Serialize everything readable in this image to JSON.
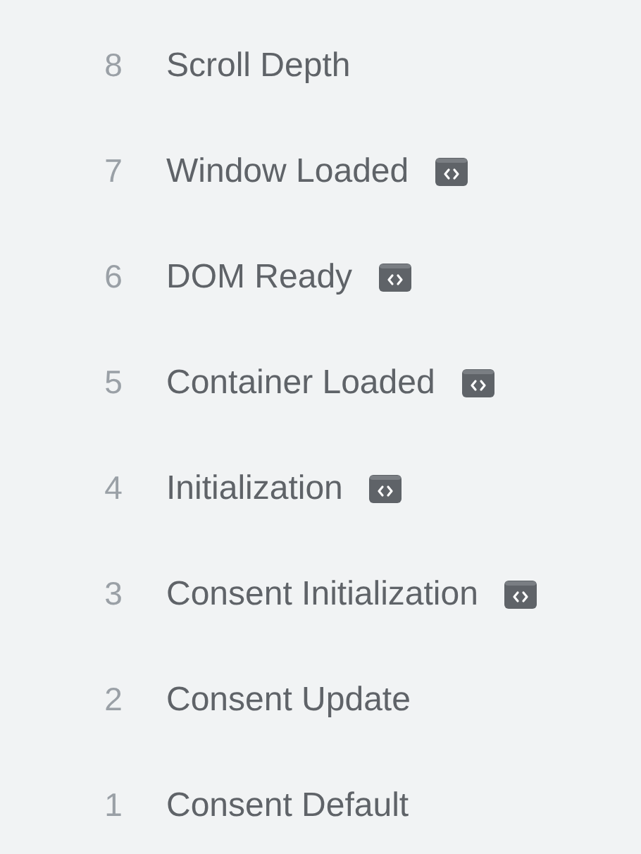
{
  "triggers": [
    {
      "number": "8",
      "name": "Scroll Depth",
      "code_icon": false
    },
    {
      "number": "7",
      "name": "Window Loaded",
      "code_icon": true
    },
    {
      "number": "6",
      "name": "DOM Ready",
      "code_icon": true
    },
    {
      "number": "5",
      "name": "Container Loaded",
      "code_icon": true
    },
    {
      "number": "4",
      "name": "Initialization",
      "code_icon": true
    },
    {
      "number": "3",
      "name": "Consent Initialization",
      "code_icon": true
    },
    {
      "number": "2",
      "name": "Consent Update",
      "code_icon": false
    },
    {
      "number": "1",
      "name": "Consent Default",
      "code_icon": false
    }
  ]
}
